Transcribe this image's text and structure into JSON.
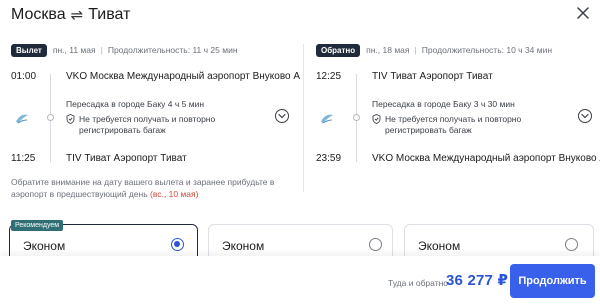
{
  "header": {
    "origin": "Москва",
    "swap_symbol": "⇌",
    "destination": "Тиват",
    "close_icon": "close-icon"
  },
  "outbound": {
    "badge": "Вылет",
    "date": "пн., 11 мая",
    "duration": "Продолжительность: 11 ч 25 мин",
    "depart_time": "01:00",
    "depart_airport": "VKO Москва Международный аэропорт Внуково А",
    "transfer": "Пересадка в городе Баку  4 ч 5 мин",
    "bag_note_1": "Не требуется получать и повторно",
    "bag_note_2": "регистрировать багаж",
    "arrive_time": "11:25",
    "arrive_airport": "TIV Тиват Аэропорт Тиват"
  },
  "inbound": {
    "badge": "Обратно",
    "date": "пн., 18 мая",
    "duration": "Продолжительность: 10 ч 34 мин",
    "depart_time": "12:25",
    "depart_airport": "TIV Тиват Аэропорт Тиват",
    "transfer": "Пересадка в городе Баку  3 ч 30 мин",
    "bag_note_1": "Не требуется получать и повторно",
    "bag_note_2": "регистрировать багаж",
    "arrive_time": "23:59",
    "arrive_airport": "VKO Москва Международный аэропорт Внуково А"
  },
  "notice": {
    "text": "Обратите внимание на дату вашего вылета и заранее прибудьте в аэропорт в предшествующий день",
    "highlight": "(вс., 10 мая)"
  },
  "fares": {
    "recommended_tag": "Рекомендуем",
    "options": [
      {
        "name": "Эконом",
        "selected": true
      },
      {
        "name": "Эконом",
        "selected": false
      },
      {
        "name": "Эконом",
        "selected": false
      }
    ]
  },
  "footer": {
    "total_label": "Туда и обратно",
    "total_price": "36 277 ₽",
    "continue_label": "Продолжить"
  },
  "colors": {
    "accent": "#3860ea",
    "badge": "#1f2a3a",
    "recommended": "#2f6f74",
    "highlight_red": "#d14a3a"
  }
}
